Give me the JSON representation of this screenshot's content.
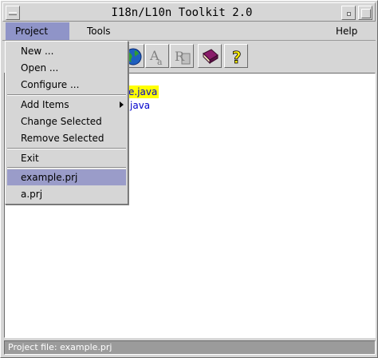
{
  "window": {
    "title": "I18n/L10n Toolkit 2.0"
  },
  "menubar": {
    "items": [
      {
        "label": "Project",
        "active": true
      },
      {
        "label": "Tools",
        "active": false
      },
      {
        "label": "Help",
        "active": false
      }
    ]
  },
  "toolbar": {
    "buttons": [
      {
        "icon": "globe-icon"
      },
      {
        "icon": "font-a-icon"
      },
      {
        "icon": "resource-r-icon"
      },
      {
        "icon": "book-icon"
      },
      {
        "icon": "question-help-icon"
      }
    ]
  },
  "content": {
    "files": [
      {
        "label": "e.java",
        "selected": true
      },
      {
        "label": "java",
        "selected": false
      }
    ]
  },
  "project_menu": {
    "items": [
      {
        "label": "New ..."
      },
      {
        "label": "Open ..."
      },
      {
        "label": "Configure ..."
      },
      {
        "label": "Add Items",
        "submenu": true
      },
      {
        "label": "Change Selected"
      },
      {
        "label": "Remove Selected"
      },
      {
        "label": "Exit"
      },
      {
        "label": "example.prj",
        "highlighted": true
      },
      {
        "label": "a.prj"
      }
    ]
  },
  "statusbar": {
    "text": "Project file: example.prj"
  },
  "colors": {
    "menu_highlight": "#9a9cc9",
    "file_selection": "#ffff00",
    "file_text": "#0000cc",
    "status_bg": "#9b9b9b"
  }
}
